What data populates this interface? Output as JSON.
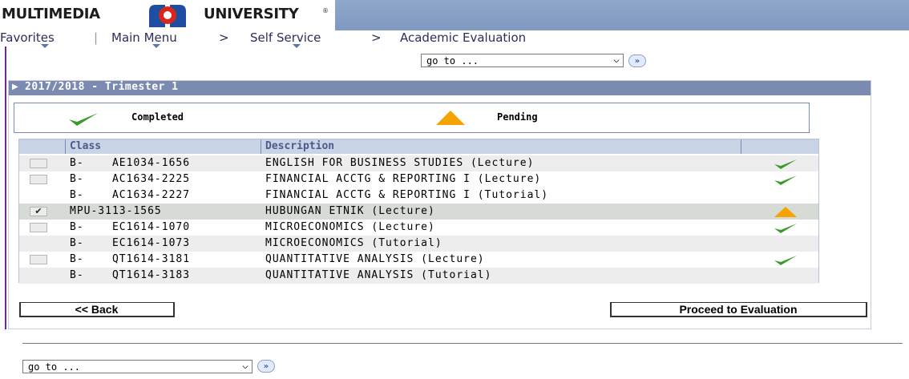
{
  "header": {
    "logo_left": "MULTIMEDIA",
    "logo_right": "UNIVERSITY",
    "trademark": "®",
    "brand_colors": {
      "red": "#d9261c",
      "blue": "#1d4ea0"
    }
  },
  "breadcrumb": {
    "favorites": "Favorites",
    "main_menu": "Main Menu",
    "sep1": ">",
    "self_service": "Self Service",
    "sep2": ">",
    "academic_evaluation": "Academic Evaluation"
  },
  "goto_top": {
    "value": "go to ...",
    "arrow": "⌵",
    "go": "»"
  },
  "panel": {
    "title": "2017/2018 - Trimester 1",
    "expand_icon": "triangle-right-icon"
  },
  "legend": {
    "completed": "Completed",
    "pending": "Pending"
  },
  "grid": {
    "columns": [
      "Class",
      "Description"
    ],
    "rows": [
      {
        "checkbox": true,
        "checked": false,
        "class": "B-    AE1034-1656",
        "description": "ENGLISH FOR BUSINESS STUDIES (Lecture)",
        "status": "completed",
        "shade": true
      },
      {
        "checkbox": true,
        "checked": false,
        "class": "B-    AC1634-2225",
        "description": "FINANCIAL ACCTG & REPORTING I (Lecture)",
        "status": "completed",
        "shade": false
      },
      {
        "checkbox": false,
        "checked": false,
        "class": "B-    AC1634-2227",
        "description": "FINANCIAL ACCTG & REPORTING I (Tutorial)",
        "status": "",
        "shade": false
      },
      {
        "checkbox": true,
        "checked": true,
        "class": "MPU-3113-1565",
        "description": "HUBUNGAN ETNIK (Lecture)",
        "status": "pending",
        "shade": "sel"
      },
      {
        "checkbox": true,
        "checked": false,
        "class": "B-    EC1614-1070",
        "description": "MICROECONOMICS (Lecture)",
        "status": "completed",
        "shade": false
      },
      {
        "checkbox": false,
        "checked": false,
        "class": "B-    EC1614-1073",
        "description": "MICROECONOMICS (Tutorial)",
        "status": "",
        "shade": true
      },
      {
        "checkbox": true,
        "checked": false,
        "class": "B-    QT1614-3181",
        "description": "QUANTITATIVE ANALYSIS (Lecture)",
        "status": "completed",
        "shade": false
      },
      {
        "checkbox": false,
        "checked": false,
        "class": "B-    QT1614-3183",
        "description": "QUANTITATIVE ANALYSIS (Tutorial)",
        "status": "",
        "shade": true
      }
    ]
  },
  "buttons": {
    "back": "<< Back",
    "proceed": "Proceed to Evaluation"
  },
  "goto_bottom": {
    "value": "go to ...",
    "arrow": "⌵",
    "go": "»"
  },
  "colors": {
    "check_green": "#3a9a2a",
    "pending_orange": "#f4a300",
    "panel_header": "#7b8ab0"
  }
}
